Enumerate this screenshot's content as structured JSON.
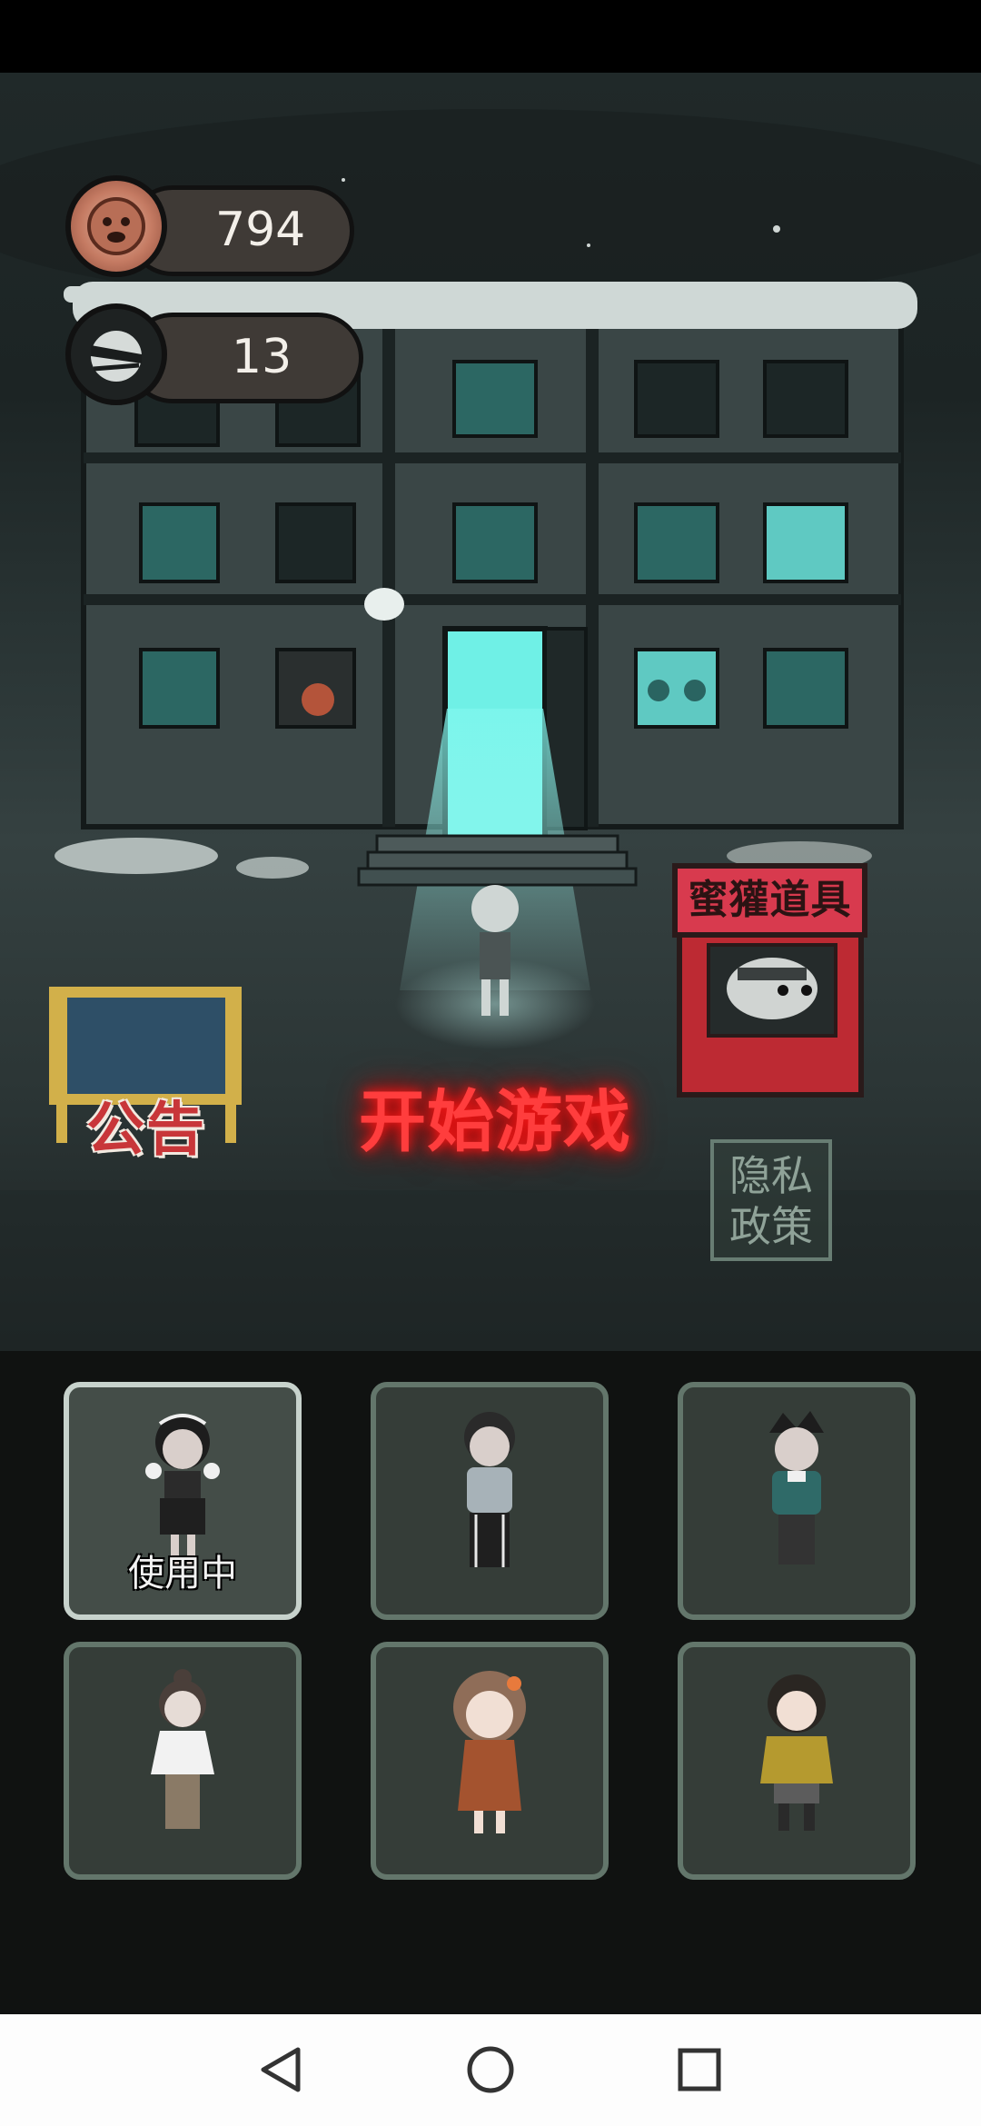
{
  "resources": {
    "coins": {
      "icon": "badger-coin-icon",
      "value": "794"
    },
    "energy": {
      "icon": "monster-head-icon",
      "value": "13"
    }
  },
  "menu": {
    "announcement_label": "公告",
    "start_label": "开始游戏",
    "shop_label": "蜜獾道具",
    "privacy_line1": "隐私",
    "privacy_line2": "政策"
  },
  "characters": [
    {
      "id": "girl-pigtails",
      "selected": true,
      "status_label": "使用中"
    },
    {
      "id": "boy-grey-hoodie",
      "selected": false
    },
    {
      "id": "boy-green-sweater",
      "selected": false
    },
    {
      "id": "girl-white-shirt",
      "selected": false
    },
    {
      "id": "girl-orange-dress",
      "selected": false
    },
    {
      "id": "girl-yellow-jacket",
      "selected": false
    }
  ],
  "navigation": {
    "back_icon": "triangle-back-icon",
    "home_icon": "circle-home-icon",
    "recents_icon": "square-recents-icon"
  },
  "colors": {
    "start_glow": "#ff3d3d",
    "shop_red": "#d83a4e",
    "window_teal": "#5fc9c2",
    "card_border": "#63766b",
    "card_selected_border": "#c7d2cc"
  }
}
